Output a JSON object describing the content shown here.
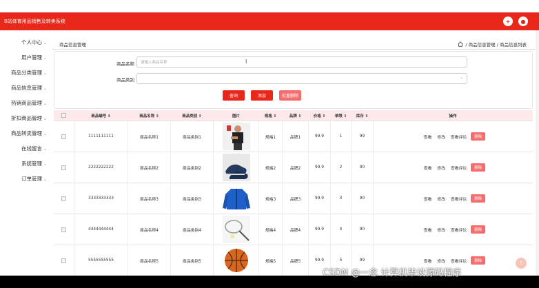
{
  "app": {
    "title": "B站体育用品销售及转卖系统"
  },
  "sidebar": {
    "items": [
      {
        "label": "个人中心"
      },
      {
        "label": "用户管理"
      },
      {
        "label": "商品分类管理"
      },
      {
        "label": "商品信息管理"
      },
      {
        "label": "热销商品管理"
      },
      {
        "label": "折扣商品管理"
      },
      {
        "label": "商品转卖管理"
      },
      {
        "label": "在线留言"
      },
      {
        "label": "系统管理"
      },
      {
        "label": "订单管理"
      }
    ]
  },
  "breadcrumb": {
    "current": "商品信息管理",
    "path": "/ 商品信息管理 / 商品信息列表"
  },
  "search": {
    "name_label": "商品名称",
    "name_placeholder": "请输入商品名称",
    "category_label": "商品类别",
    "query_button": "查询",
    "add_button": "添加",
    "batch_delete_button": "批量删除"
  },
  "table": {
    "headers": [
      "商品编号 ⇕",
      "商品名称 ⇕",
      "商品类别 ⇕",
      "图片",
      "规格 ⇕",
      "品牌 ⇕",
      "价格 ⇕",
      "单限 ⇕",
      "库存 ⇕",
      "操作"
    ],
    "rows": [
      {
        "code": "1111111111",
        "name": "商品名称1",
        "category": "商品类别1",
        "spec": "规格1",
        "brand": "品牌1",
        "price": "99.9",
        "limit": "1",
        "stock": "99",
        "image": "person"
      },
      {
        "code": "2222222222",
        "name": "商品名称2",
        "category": "商品类别2",
        "spec": "规格2",
        "brand": "品牌2",
        "price": "99.9",
        "limit": "2",
        "stock": "90",
        "image": "shoes"
      },
      {
        "code": "3333333333",
        "name": "商品名称3",
        "category": "商品类别3",
        "spec": "规格3",
        "brand": "品牌3",
        "price": "99.9",
        "limit": "3",
        "stock": "90",
        "image": "jacket"
      },
      {
        "code": "4444444444",
        "name": "商品名称4",
        "category": "商品类别4",
        "spec": "规格4",
        "brand": "品牌4",
        "price": "99.9",
        "limit": "4",
        "stock": "90",
        "image": "racket"
      },
      {
        "code": "5555555555",
        "name": "商品名称5",
        "category": "商品类别5",
        "spec": "规格5",
        "brand": "品牌5",
        "price": "99.9",
        "limit": "5",
        "stock": "99",
        "image": "ball"
      }
    ],
    "actions": {
      "view": "查看",
      "edit": "修改",
      "review": "查看评论",
      "delete": "删除"
    }
  },
  "watermark": "CSDN @一念 计算机毕设源码程序",
  "colors": {
    "brand": "#e8281a",
    "delete": "#f56c6c",
    "header_bg": "#fde8ea"
  }
}
